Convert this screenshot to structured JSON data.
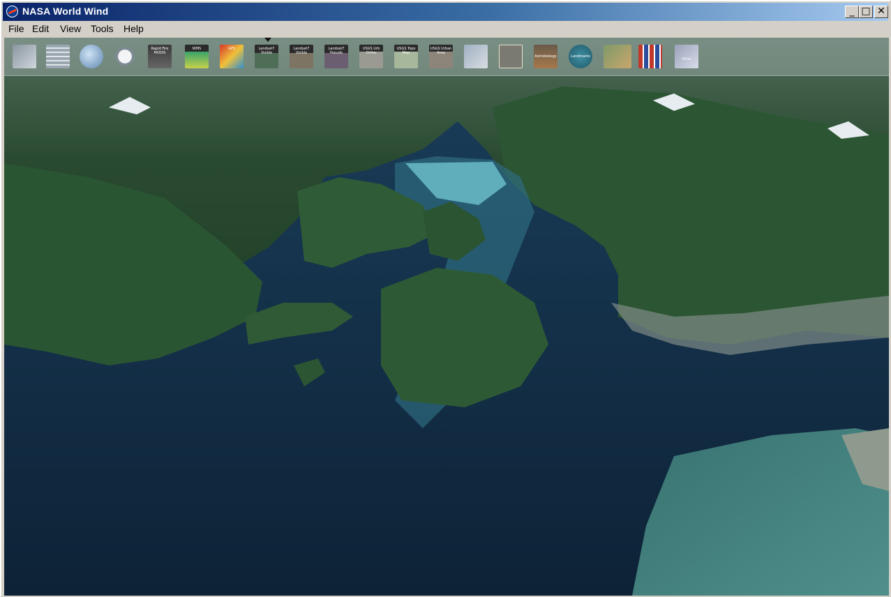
{
  "window": {
    "title": "NASA World Wind",
    "minimize": "_",
    "maximize": "□",
    "close": "✕"
  },
  "menu": {
    "file": "File",
    "edit": "Edit",
    "view": "View",
    "tools": "Tools",
    "help": "Help"
  },
  "toolbar": {
    "items": [
      {
        "icon": "layer-stack-icon",
        "label": ""
      },
      {
        "icon": "lat-lon-grid-icon",
        "label": ""
      },
      {
        "icon": "globe-icon",
        "label": ""
      },
      {
        "icon": "place-finder-magnifier-icon",
        "label": ""
      },
      {
        "icon": "modis-icon",
        "label": "Rapid Fire MODIS"
      },
      {
        "icon": "wms-icon",
        "label": "WMS"
      },
      {
        "icon": "gps-color-icon",
        "label": "GPS"
      },
      {
        "icon": "landsat-visible-icon",
        "label": "Landsat7 Visible"
      },
      {
        "icon": "landsat-visible-2-icon",
        "label": "Landsat7 Visible"
      },
      {
        "icon": "landsat-pseudo-icon",
        "label": "Landsat7 Pseudo"
      },
      {
        "icon": "usgs-urban-ortho-icon",
        "label": "USGS Urb Ortho"
      },
      {
        "icon": "usgs-topo-map-icon",
        "label": "USGS Topo Map"
      },
      {
        "icon": "usgs-urban-area-icon",
        "label": "USGS Urban Area"
      },
      {
        "icon": "boundaries-map-icon",
        "label": ""
      },
      {
        "icon": "place-names-icon",
        "label": ""
      },
      {
        "icon": "astrobiology-icon",
        "label": "Astrobiology"
      },
      {
        "icon": "landmarks-icon",
        "label": "Landmarks"
      },
      {
        "icon": "usa-map-icon",
        "label": ""
      },
      {
        "icon": "flags-icon",
        "label": ""
      },
      {
        "icon": "other-layers-icon",
        "label": "Other"
      }
    ]
  },
  "colors": {
    "titlebar_start": "#0a246a",
    "titlebar_end": "#a6caf0",
    "chrome": "#d4d0c8"
  }
}
